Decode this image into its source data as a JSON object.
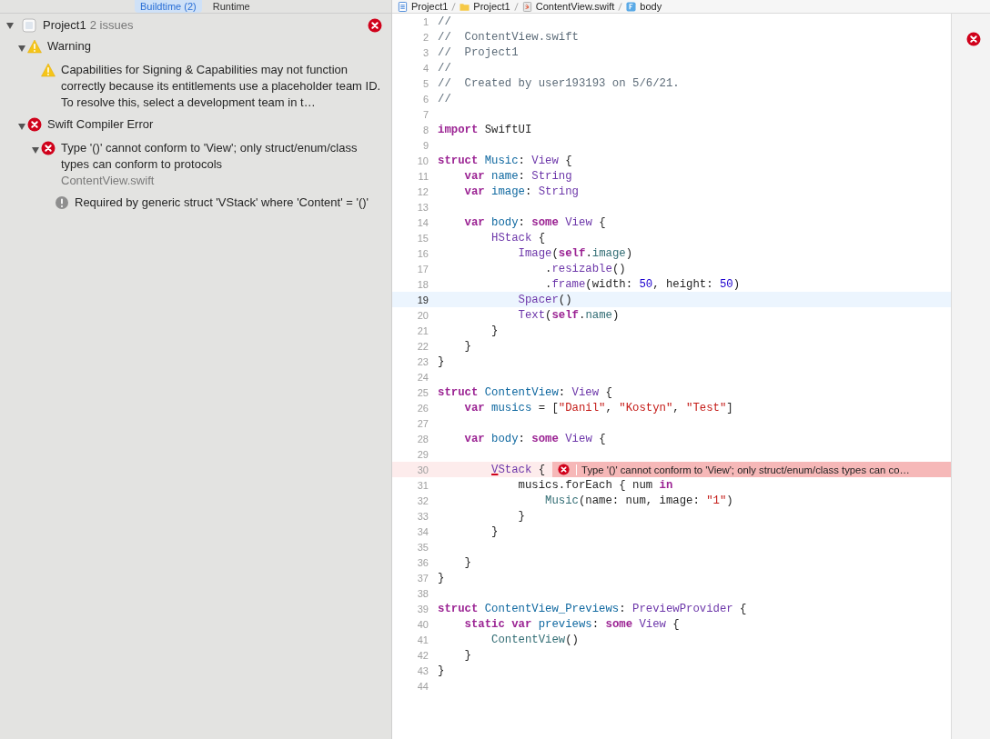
{
  "navigator": {
    "tabs": [
      {
        "label": "Buildtime (2)",
        "selected": true
      },
      {
        "label": "Runtime",
        "selected": false
      }
    ],
    "project": {
      "name": "Project1",
      "count": "2 issues",
      "expanded": true,
      "has_errors": true
    },
    "issues": [
      {
        "kind": "warning",
        "text": "Warning",
        "expanded": true,
        "children": [
          {
            "kind": "warning",
            "text": "Capabilities for Signing & Capabilities may not function correctly because its entitlements use a placeholder team ID. To resolve this, select a development team in t…"
          }
        ]
      },
      {
        "kind": "error",
        "text": "Swift Compiler Error",
        "expanded": true,
        "children": [
          {
            "kind": "error",
            "text": "Type '()' cannot conform to 'View'; only struct/enum/class types can conform to protocols",
            "file": "ContentView.swift",
            "expanded": true,
            "children": [
              {
                "kind": "note",
                "text": "Required by generic struct 'VStack' where 'Content' = '()'"
              }
            ]
          }
        ]
      }
    ]
  },
  "breadcrumb": [
    {
      "kind": "project",
      "label": "Project1"
    },
    {
      "kind": "folder",
      "label": "Project1"
    },
    {
      "kind": "swift",
      "label": "ContentView.swift"
    },
    {
      "kind": "property",
      "label": "body"
    }
  ],
  "editor": {
    "lines": [
      {
        "number": "1",
        "current": false,
        "tokens": [
          {
            "kind": "comment",
            "text": "//"
          }
        ]
      },
      {
        "number": "2",
        "current": false,
        "tokens": [
          {
            "kind": "comment",
            "text": "//  ContentView.swift"
          }
        ]
      },
      {
        "number": "3",
        "current": false,
        "tokens": [
          {
            "kind": "comment",
            "text": "//  Project1"
          }
        ]
      },
      {
        "number": "4",
        "current": false,
        "tokens": [
          {
            "kind": "comment",
            "text": "//"
          }
        ]
      },
      {
        "number": "5",
        "current": false,
        "tokens": [
          {
            "kind": "comment",
            "text": "//  Created by user193193 on 5/6/21."
          }
        ]
      },
      {
        "number": "6",
        "current": false,
        "tokens": [
          {
            "kind": "comment",
            "text": "//"
          }
        ]
      },
      {
        "number": "7",
        "current": false
      },
      {
        "number": "8",
        "current": false,
        "tokens": [
          {
            "kind": "keyword",
            "text": "import"
          },
          {
            "kind": "plain",
            "text": " SwiftUI"
          }
        ]
      },
      {
        "number": "9",
        "current": false
      },
      {
        "number": "10",
        "current": false,
        "tokens": [
          {
            "kind": "keyword",
            "text": "struct"
          },
          {
            "kind": "decl",
            "text": " Music"
          },
          {
            "kind": "plain",
            "text": ": "
          },
          {
            "kind": "sdk",
            "text": "View"
          },
          {
            "kind": "plain",
            "text": " {"
          }
        ]
      },
      {
        "number": "11",
        "current": false,
        "tokens": [
          {
            "kind": "keyword",
            "text": "    var"
          },
          {
            "kind": "decl",
            "text": " name"
          },
          {
            "kind": "plain",
            "text": ": "
          },
          {
            "kind": "sdk",
            "text": "String"
          }
        ]
      },
      {
        "number": "12",
        "current": false,
        "tokens": [
          {
            "kind": "keyword",
            "text": "    var"
          },
          {
            "kind": "decl",
            "text": " image"
          },
          {
            "kind": "plain",
            "text": ": "
          },
          {
            "kind": "sdk",
            "text": "String"
          }
        ]
      },
      {
        "number": "13",
        "current": false
      },
      {
        "number": "14",
        "current": false,
        "tokens": [
          {
            "kind": "keyword",
            "text": "    var"
          },
          {
            "kind": "decl",
            "text": " body"
          },
          {
            "kind": "plain",
            "text": ": "
          },
          {
            "kind": "keyword",
            "text": "some"
          },
          {
            "kind": "sdk",
            "text": " View"
          },
          {
            "kind": "plain",
            "text": " {"
          }
        ]
      },
      {
        "number": "15",
        "current": false,
        "tokens": [
          {
            "kind": "sdk",
            "text": "        HStack"
          },
          {
            "kind": "plain",
            "text": " {"
          }
        ]
      },
      {
        "number": "16",
        "current": false,
        "tokens": [
          {
            "kind": "sdk",
            "text": "            Image"
          },
          {
            "kind": "plain",
            "text": "("
          },
          {
            "kind": "keyword",
            "text": "self"
          },
          {
            "kind": "plain",
            "text": "."
          },
          {
            "kind": "project",
            "text": "image"
          },
          {
            "kind": "plain",
            "text": ")"
          }
        ]
      },
      {
        "number": "17",
        "current": false,
        "tokens": [
          {
            "kind": "plain",
            "text": "                ."
          },
          {
            "kind": "sdk",
            "text": "resizable"
          },
          {
            "kind": "plain",
            "text": "()"
          }
        ]
      },
      {
        "number": "18",
        "current": false,
        "tokens": [
          {
            "kind": "plain",
            "text": "                ."
          },
          {
            "kind": "sdk",
            "text": "frame"
          },
          {
            "kind": "plain",
            "text": "(width: "
          },
          {
            "kind": "number",
            "text": "50"
          },
          {
            "kind": "plain",
            "text": ", height: "
          },
          {
            "kind": "number",
            "text": "50"
          },
          {
            "kind": "plain",
            "text": ")"
          }
        ]
      },
      {
        "number": "19",
        "current": true,
        "tokens": [
          {
            "kind": "sdk",
            "text": "            Spacer"
          },
          {
            "kind": "plain",
            "text": "()"
          }
        ]
      },
      {
        "number": "20",
        "current": false,
        "tokens": [
          {
            "kind": "sdk",
            "text": "            Text"
          },
          {
            "kind": "plain",
            "text": "("
          },
          {
            "kind": "keyword",
            "text": "self"
          },
          {
            "kind": "plain",
            "text": "."
          },
          {
            "kind": "project",
            "text": "name"
          },
          {
            "kind": "plain",
            "text": ")"
          }
        ]
      },
      {
        "number": "21",
        "current": false,
        "tokens": [
          {
            "kind": "plain",
            "text": "        }"
          }
        ]
      },
      {
        "number": "22",
        "current": false,
        "tokens": [
          {
            "kind": "plain",
            "text": "    }"
          }
        ]
      },
      {
        "number": "23",
        "current": false,
        "tokens": [
          {
            "kind": "plain",
            "text": "}"
          }
        ]
      },
      {
        "number": "24",
        "current": false
      },
      {
        "number": "25",
        "current": false,
        "tokens": [
          {
            "kind": "keyword",
            "text": "struct"
          },
          {
            "kind": "decl",
            "text": " ContentView"
          },
          {
            "kind": "plain",
            "text": ": "
          },
          {
            "kind": "sdk",
            "text": "View"
          },
          {
            "kind": "plain",
            "text": " {"
          }
        ]
      },
      {
        "number": "26",
        "current": false,
        "tokens": [
          {
            "kind": "keyword",
            "text": "    var"
          },
          {
            "kind": "decl",
            "text": " musics"
          },
          {
            "kind": "plain",
            "text": " = ["
          },
          {
            "kind": "string",
            "text": "\"Danil\""
          },
          {
            "kind": "plain",
            "text": ", "
          },
          {
            "kind": "string",
            "text": "\"Kostyn\""
          },
          {
            "kind": "plain",
            "text": ", "
          },
          {
            "kind": "string",
            "text": "\"Test\""
          },
          {
            "kind": "plain",
            "text": "]"
          }
        ]
      },
      {
        "number": "27",
        "current": false
      },
      {
        "number": "28",
        "current": false,
        "tokens": [
          {
            "kind": "keyword",
            "text": "    var"
          },
          {
            "kind": "decl",
            "text": " body"
          },
          {
            "kind": "plain",
            "text": ": "
          },
          {
            "kind": "keyword",
            "text": "some"
          },
          {
            "kind": "sdk",
            "text": " View"
          },
          {
            "kind": "plain",
            "text": " {"
          }
        ]
      },
      {
        "number": "29",
        "current": false
      },
      {
        "number": "30",
        "current": false,
        "error": "Type '()' cannot conform to 'View'; only struct/enum/class types can co…",
        "tokens": [
          {
            "kind": "sdk",
            "text": "        VStack"
          },
          {
            "kind": "plain",
            "text": " {"
          }
        ]
      },
      {
        "number": "31",
        "current": false,
        "tokens": [
          {
            "kind": "plain",
            "text": "            musics.forEach { num "
          },
          {
            "kind": "keyword",
            "text": "in"
          }
        ]
      },
      {
        "number": "32",
        "current": false,
        "tokens": [
          {
            "kind": "project",
            "text": "                Music"
          },
          {
            "kind": "plain",
            "text": "(name: num, image: "
          },
          {
            "kind": "string",
            "text": "\"1\""
          },
          {
            "kind": "plain",
            "text": ")"
          }
        ]
      },
      {
        "number": "33",
        "current": false,
        "tokens": [
          {
            "kind": "plain",
            "text": "            }"
          }
        ]
      },
      {
        "number": "34",
        "current": false,
        "tokens": [
          {
            "kind": "plain",
            "text": "        }"
          }
        ]
      },
      {
        "number": "35",
        "current": false
      },
      {
        "number": "36",
        "current": false,
        "tokens": [
          {
            "kind": "plain",
            "text": "    }"
          }
        ]
      },
      {
        "number": "37",
        "current": false,
        "tokens": [
          {
            "kind": "plain",
            "text": "}"
          }
        ]
      },
      {
        "number": "38",
        "current": false
      },
      {
        "number": "39",
        "current": false,
        "tokens": [
          {
            "kind": "keyword",
            "text": "struct"
          },
          {
            "kind": "decl",
            "text": " ContentView_Previews"
          },
          {
            "kind": "plain",
            "text": ": "
          },
          {
            "kind": "sdk",
            "text": "PreviewProvider"
          },
          {
            "kind": "plain",
            "text": " {"
          }
        ]
      },
      {
        "number": "40",
        "current": false,
        "tokens": [
          {
            "kind": "keyword",
            "text": "    static var"
          },
          {
            "kind": "decl",
            "text": " previews"
          },
          {
            "kind": "plain",
            "text": ": "
          },
          {
            "kind": "keyword",
            "text": "some"
          },
          {
            "kind": "sdk",
            "text": " View"
          },
          {
            "kind": "plain",
            "text": " {"
          }
        ]
      },
      {
        "number": "41",
        "current": false,
        "tokens": [
          {
            "kind": "project",
            "text": "        ContentView"
          },
          {
            "kind": "plain",
            "text": "()"
          }
        ]
      },
      {
        "number": "42",
        "current": false,
        "tokens": [
          {
            "kind": "plain",
            "text": "    }"
          }
        ]
      },
      {
        "number": "43",
        "current": false,
        "tokens": [
          {
            "kind": "plain",
            "text": "}"
          }
        ]
      },
      {
        "number": "44",
        "current": false
      }
    ]
  },
  "minimap": {
    "has_errors": true
  }
}
